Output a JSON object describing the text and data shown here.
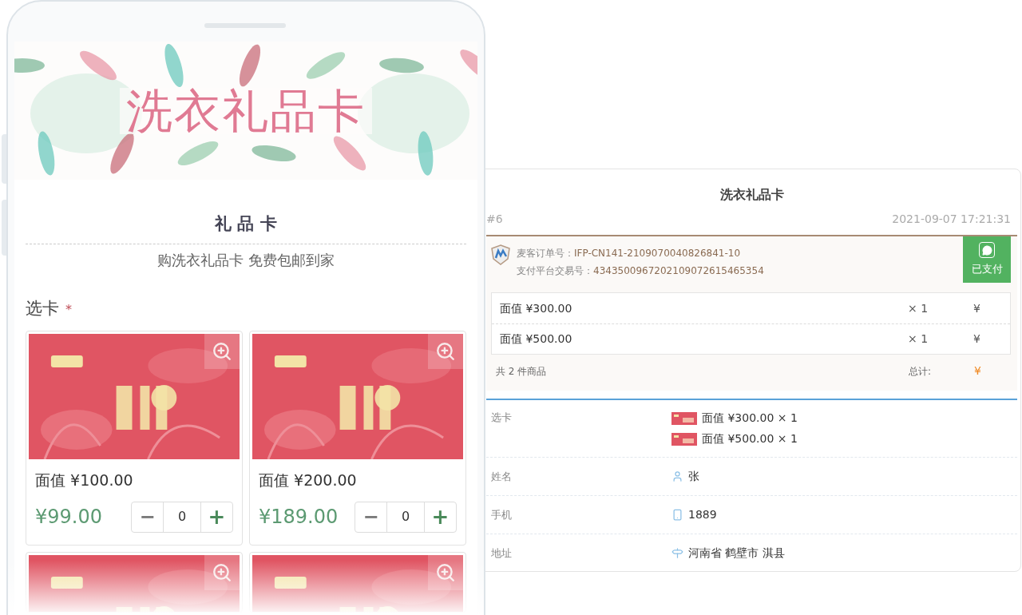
{
  "phone": {
    "banner": {
      "title": "洗衣礼品卡"
    },
    "heading": "礼 品 卡",
    "subtitle": "购洗衣礼品卡 免费包邮到家",
    "field": {
      "label": "选卡",
      "required_mark": "*"
    },
    "cards": [
      {
        "face": "面值 ¥100.00",
        "price": "¥99.00",
        "quantity": "0"
      },
      {
        "face": "面值 ¥200.00",
        "price": "¥189.00",
        "quantity": "0"
      },
      {
        "kind": "picture"
      },
      {
        "kind": "picture"
      }
    ],
    "stepper": {
      "minus": "−",
      "plus": "+"
    }
  },
  "order": {
    "title": "洗衣礼品卡",
    "number": "#6",
    "time": "2021-09-07 17:21:31",
    "order_no": {
      "label": "麦客订单号：",
      "value": "IFP-CN141-2109070040826841-10"
    },
    "trade_no": {
      "label": "支付平台交易号：",
      "value": "4343500967202109072615465354"
    },
    "status": "已支付",
    "items": [
      {
        "name": "面值 ¥300.00",
        "qty": "× 1",
        "amount": "¥"
      },
      {
        "name": "面值 ¥500.00",
        "qty": "× 1",
        "amount": "¥"
      }
    ],
    "count": "共 2 件商品",
    "total_label": "总计:",
    "total": "¥",
    "fields": [
      {
        "kind": "cards",
        "label": "选卡",
        "values": [
          "面值 ¥300.00 × 1",
          "面值 ¥500.00 × 1"
        ]
      },
      {
        "kind": "name",
        "label": "姓名",
        "values": [
          "张"
        ]
      },
      {
        "kind": "phone",
        "label": "手机",
        "values": [
          "1889"
        ]
      },
      {
        "kind": "address",
        "label": "地址",
        "values": [
          "河南省 鹤壁市 淇县"
        ]
      }
    ]
  }
}
